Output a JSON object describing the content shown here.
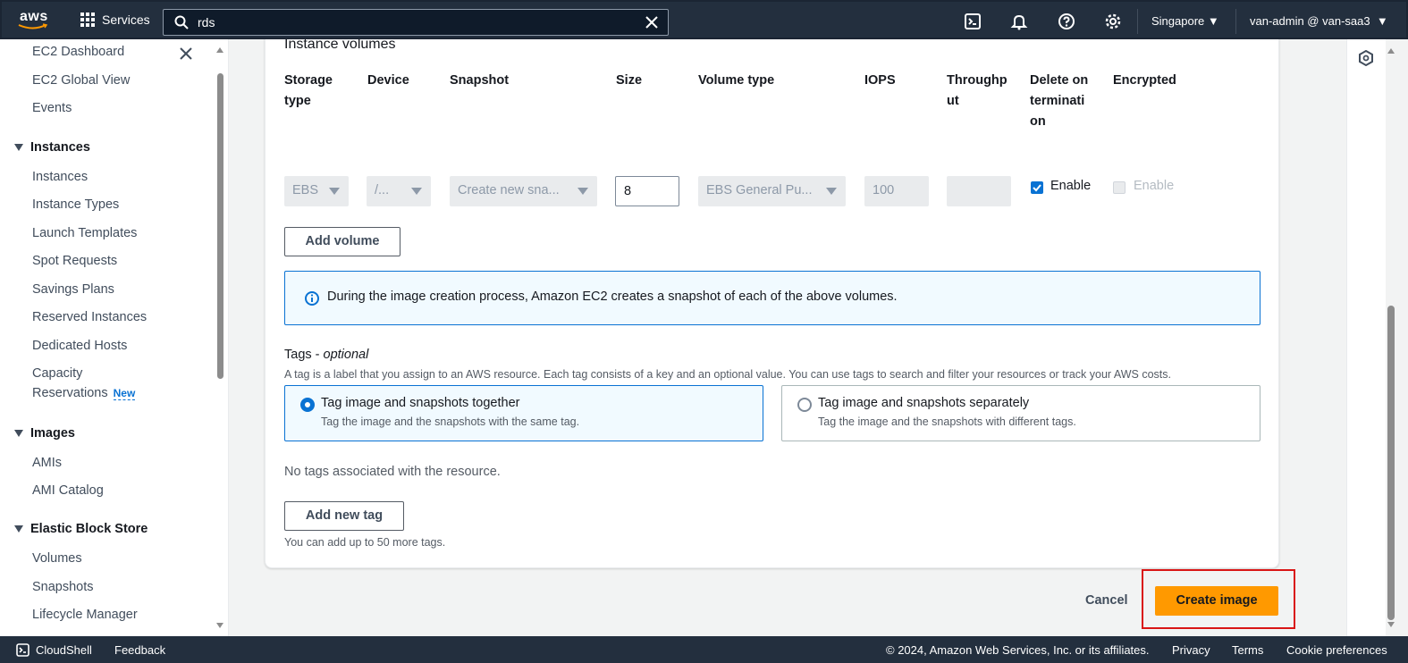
{
  "topnav": {
    "logo_text": "aws",
    "services_label": "Services",
    "search_value": "rds",
    "region": "Singapore",
    "user": "van-admin @ van-saa3"
  },
  "sidebar": {
    "items": {
      "ec2_dashboard": "EC2 Dashboard",
      "ec2_global_view": "EC2 Global View",
      "events": "Events",
      "instances_header": "Instances",
      "instances": "Instances",
      "instance_types": "Instance Types",
      "launch_templates": "Launch Templates",
      "spot_requests": "Spot Requests",
      "savings_plans": "Savings Plans",
      "reserved_instances": "Reserved Instances",
      "dedicated_hosts": "Dedicated Hosts",
      "capacity_line1": "Capacity",
      "capacity_line2": "Reservations",
      "new_badge": "New",
      "images_header": "Images",
      "amis": "AMIs",
      "ami_catalog": "AMI Catalog",
      "ebs_header": "Elastic Block Store",
      "volumes": "Volumes",
      "snapshots": "Snapshots",
      "lifecycle_manager": "Lifecycle Manager"
    }
  },
  "main": {
    "section_title": "Instance volumes",
    "columns": {
      "storage_type": [
        "Storage",
        "type"
      ],
      "device": "Device",
      "snapshot": "Snapshot",
      "size": "Size",
      "volume_type": "Volume type",
      "iops": "IOPS",
      "throughput": [
        "Throughp",
        "ut"
      ],
      "delete_on_termination": [
        "Delete on",
        "terminati",
        "on"
      ],
      "encrypted": "Encrypted"
    },
    "row": {
      "storage_type": "EBS",
      "device": "/...",
      "snapshot": "Create new sna...",
      "size": "8",
      "volume_type": "EBS General Pu...",
      "iops": "100",
      "throughput": "",
      "delete_on_termination_label": "Enable",
      "delete_on_termination_checked": true,
      "encrypted_label": "Enable",
      "encrypted_checked": false
    },
    "add_volume": "Add volume",
    "info_text": "During the image creation process, Amazon EC2 creates a snapshot of each of the above volumes.",
    "tags": {
      "label": "Tags - ",
      "label_optional": "optional",
      "description": "A tag is a label that you assign to an AWS resource. Each tag consists of a key and an optional value. You can use tags to search and filter your resources or track your AWS costs.",
      "option_together_title": "Tag image and snapshots together",
      "option_together_desc": "Tag the image and the snapshots with the same tag.",
      "option_separately_title": "Tag image and snapshots separately",
      "option_separately_desc": "Tag the image and the snapshots with different tags.",
      "selected": "together",
      "no_tags": "No tags associated with the resource.",
      "add_new_tag": "Add new tag",
      "hint": "You can add up to 50 more tags."
    },
    "cancel": "Cancel",
    "create_image": "Create image"
  },
  "footer": {
    "cloudshell": "CloudShell",
    "feedback": "Feedback",
    "copyright": "© 2024, Amazon Web Services, Inc. or its affiliates.",
    "privacy": "Privacy",
    "terms": "Terms",
    "cookie": "Cookie preferences"
  },
  "colors": {
    "nav_bg": "#232f3e",
    "primary_button": "#ff9900",
    "link_blue": "#0972d3",
    "highlight_red": "#d91515"
  }
}
